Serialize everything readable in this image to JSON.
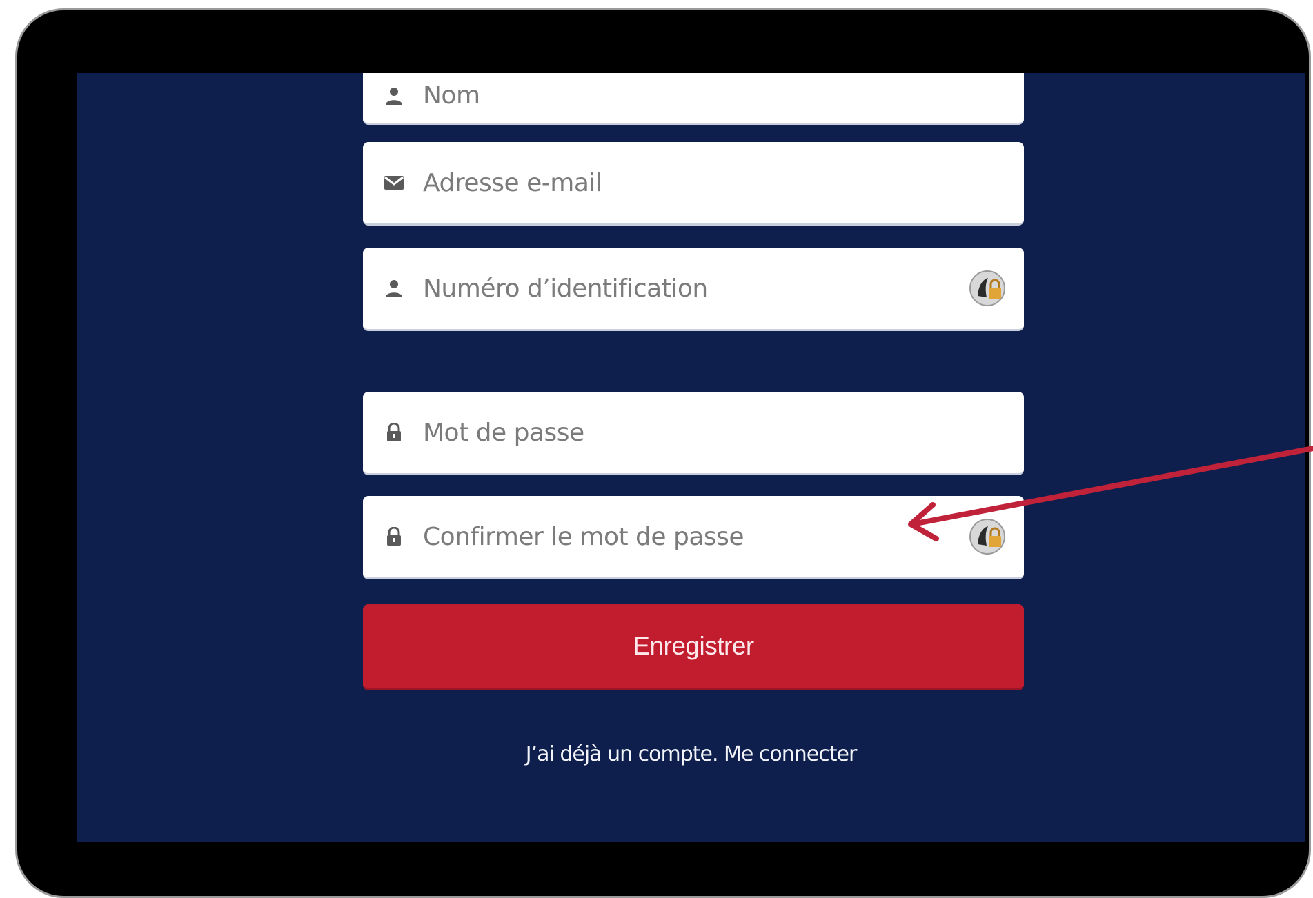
{
  "form": {
    "fields": [
      {
        "placeholder": "Nom",
        "icon": "user-icon"
      },
      {
        "placeholder": "Adresse e-mail",
        "icon": "envelope-icon"
      },
      {
        "placeholder": "Numéro d’identification",
        "icon": "user-icon",
        "badge": "password-manager-icon"
      },
      {
        "placeholder": "Mot de passe",
        "icon": "lock-icon"
      },
      {
        "placeholder": "Confirmer le mot de passe",
        "icon": "lock-icon",
        "badge": "password-manager-icon"
      }
    ],
    "submit_label": "Enregistrer",
    "login_link": "J’ai déjà un compte. Me connecter"
  },
  "colors": {
    "background": "#0e1f4d",
    "button": "#c21d2f",
    "annotation_arrow": "#c0223a",
    "device_frame": "#000000"
  }
}
